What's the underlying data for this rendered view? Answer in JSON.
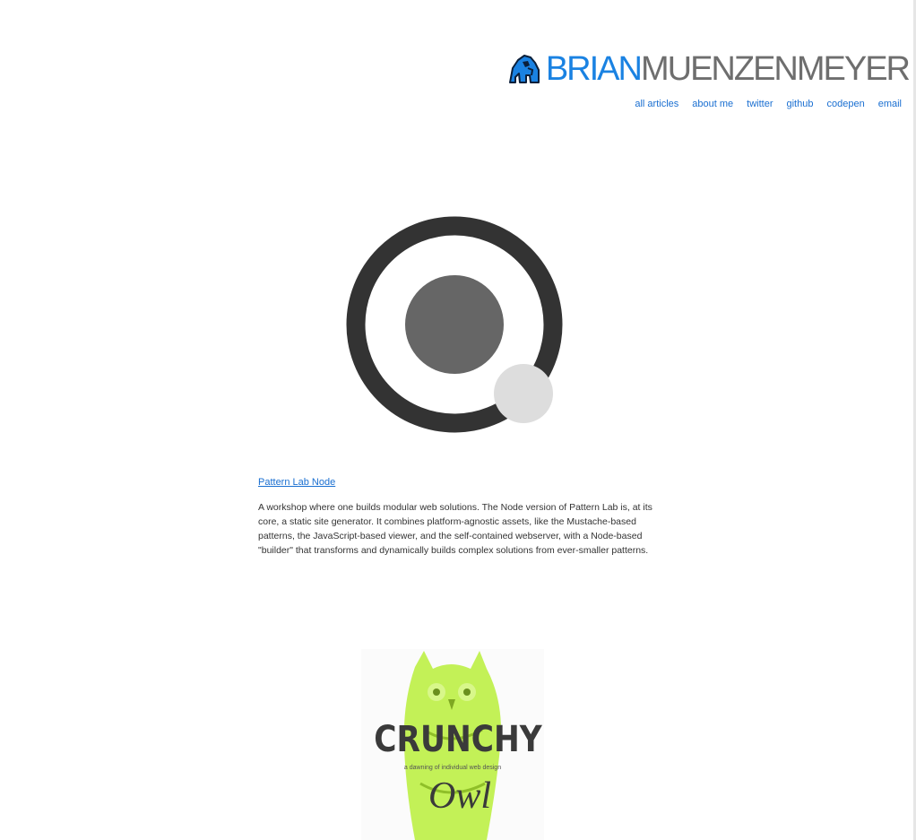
{
  "site": {
    "brand_first": "BRIAN",
    "brand_last": "MUENZENMEYER",
    "logo_icon": "gorilla-logo-icon",
    "colors": {
      "brand_blue": "#1a82e2",
      "brand_gray": "#6e6e6e",
      "link": "#1a6fd1"
    }
  },
  "nav": {
    "items": [
      {
        "label": "all articles"
      },
      {
        "label": "about me"
      },
      {
        "label": "twitter"
      },
      {
        "label": "github"
      },
      {
        "label": "codepen"
      },
      {
        "label": "email"
      }
    ]
  },
  "projects": [
    {
      "title": "Pattern Lab Node",
      "description": "A workshop where one builds modular web solutions. The Node version of Pattern Lab is, at its core, a static site generator. It combines platform-agnostic assets, like the Mustache-based patterns, the JavaScript-based viewer, and the self-contained webserver, with a Node-based \"builder\" that transforms and dynamically builds complex solutions from ever-smaller patterns.",
      "image_icon": "pattern-lab-logo-icon"
    },
    {
      "image_icon": "crunchy-owl-logo-icon",
      "logo_title": "CRUNCHY",
      "logo_tagline": "a dawning of individual web design",
      "logo_word": "Owl"
    }
  ]
}
